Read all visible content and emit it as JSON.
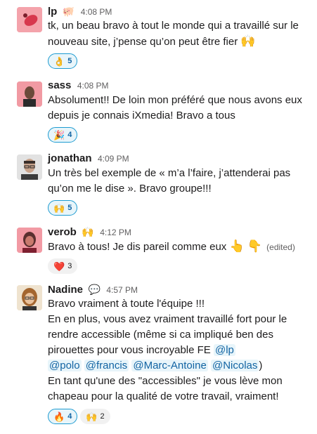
{
  "messages": [
    {
      "author": "lp",
      "status_emoji": "🐖",
      "time": "4:08 PM",
      "text": "tk, un beau bravo à tout le monde qui a travaillé sur le nouveau site, j’pense qu’on peut être fier",
      "inline_emoji": "🙌",
      "reactions": [
        {
          "emoji": "👌",
          "count": "5",
          "active": true
        }
      ]
    },
    {
      "author": "sass",
      "time": "4:08 PM",
      "text": "Absolument!! De loin mon préféré que nous avons eux depuis je connais iXmedia! Bravo a tous",
      "reactions": [
        {
          "emoji": "🎉",
          "count": "4",
          "active": true
        }
      ]
    },
    {
      "author": "jonathan",
      "time": "4:09 PM",
      "text": "Un très bel exemple de « m’a l’faire, j’attenderai pas qu’on me le dise ». Bravo groupe!!!",
      "reactions": [
        {
          "emoji": "🙌",
          "count": "5",
          "active": true
        }
      ]
    },
    {
      "author": "verob",
      "status_emoji": "🙌",
      "time": "4:12 PM",
      "text": "Bravo à tous! Je dis pareil comme eux",
      "inline_emoji_1": "👆",
      "inline_emoji_2": "👇",
      "edited": "(edited)",
      "reactions": [
        {
          "emoji": "❤️",
          "count": "3",
          "active": false
        }
      ]
    },
    {
      "author": "Nadine",
      "status_emoji": "💬",
      "time": "4:57 PM",
      "line1": "Bravo vraiment à toute l'équipe !!!",
      "line2": "En en plus, vous avez vraiment travaillé fort pour le rendre accessible (même si ca impliqué ben des pirouettes pour vous incroyable FE",
      "mentions": [
        "@lp",
        "@polo",
        "@francis",
        "@Marc-Antoine",
        "@Nicolas"
      ],
      "close_paren": ")",
      "line3": "En tant qu'une des \"accessibles\" je vous lève mon chapeau pour la qualité de votre travail, vraiment!",
      "reactions": [
        {
          "emoji": "🔥",
          "count": "4",
          "active": true
        },
        {
          "emoji": "🙌",
          "count": "2",
          "active": false
        }
      ]
    }
  ]
}
